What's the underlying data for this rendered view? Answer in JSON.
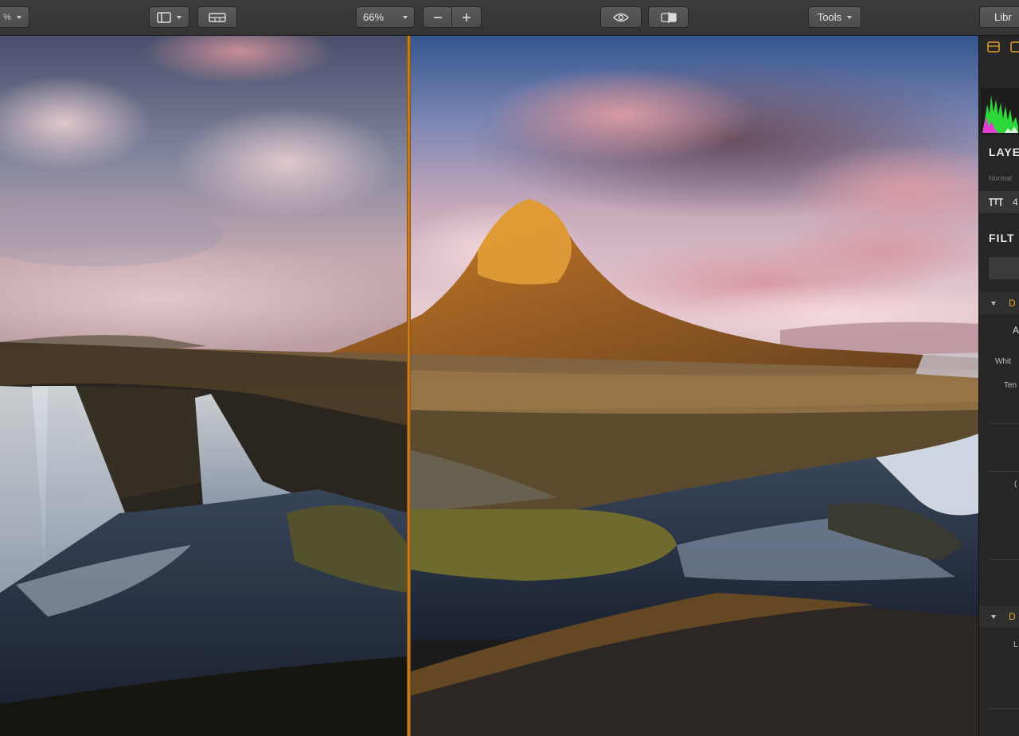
{
  "toolbar": {
    "left_cut_label": "%",
    "zoom_value": "66%",
    "tools_label": "Tools",
    "library_label": "Libr",
    "colors": {
      "bar": "#3a3a3a",
      "button": "#525252"
    }
  },
  "canvas": {
    "split_view": true,
    "divider_color": "#e08a22"
  },
  "panel": {
    "layers_title": "LAYE",
    "blend_mode": "Normal",
    "layer_value": "4",
    "filters_title": "FILT",
    "section1_title": "D",
    "row_a": "A",
    "white_label": "Whit",
    "tem_label": "Ten",
    "small_label": "(",
    "section2_title": "D",
    "l_label": "L"
  }
}
